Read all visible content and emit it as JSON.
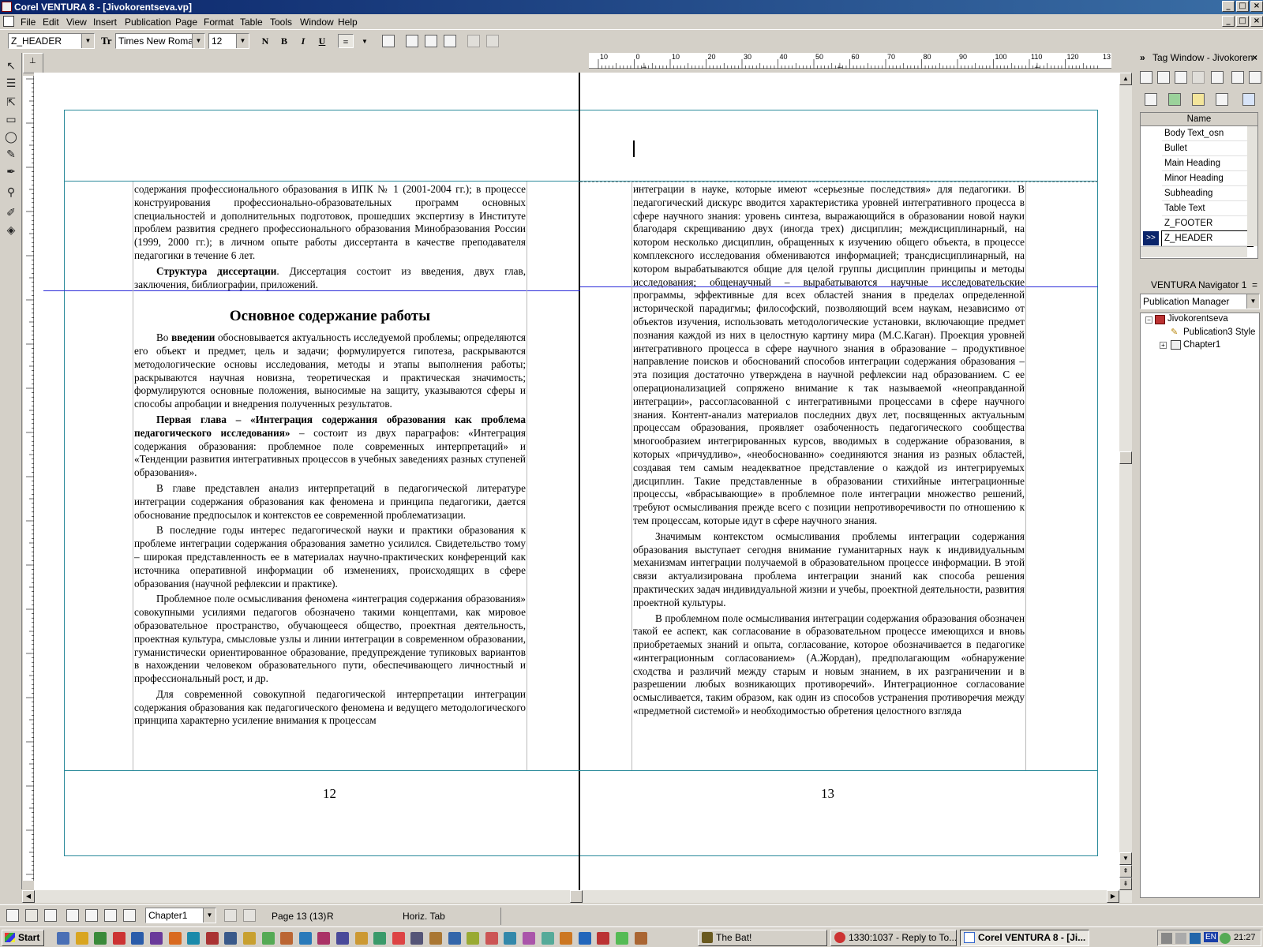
{
  "window": {
    "title": "Corel VENTURA 8 - [Jivokorentseva.vp]"
  },
  "menu": [
    "File",
    "Edit",
    "View",
    "Insert",
    "Publication",
    "Page",
    "Format",
    "Table",
    "Tools",
    "Window",
    "Help"
  ],
  "toolbar": {
    "tag_value": "Z_HEADER",
    "font_value": "Times New Roman",
    "size_value": "12",
    "normal_label": "N",
    "bold_label": "B",
    "italic_label": "I",
    "underline_label": "U"
  },
  "left_page": {
    "paragraph_1": "содержания профессионального образования в ИПК № 1 (2001-2004 гг.); в процессе конструирования профессионально-образовательных программ основных специальностей и дополнительных подготовок, прошедших экспертизу в Институте проблем развития среднего профессионального образования Минобразования России (1999, 2000 гг.); в личном опыте работы диссертанта в качестве преподавателя педагогики в течение 6 лет.",
    "structure_bold": "Структура диссертации",
    "structure_text": ". Диссертация состоит из введения, двух глав, заключения, библиографии, приложений.",
    "heading": "Основное содержание работы",
    "intro_pre": "Во ",
    "intro_bold": "введении",
    "intro_text": " обосновывается актуальность исследуемой проблемы; определяются его объект и предмет, цель и задачи; формулируется гипотеза, раскрываются методологические основы исследования, методы и этапы выполнения работы; раскрываются научная новизна, теоретическая и практическая значимость; формулируются основные положения, выносимые на защиту, указываются сферы и способы апробации и внедрения полученных результатов.",
    "chapter_bold": "Первая глава – «Интеграция содержания образования как проблема педагогического исследования»",
    "chapter_text": " – состоит из двух параграфов: «Интеграция содержания образования: проблемное поле современных интерпретаций» и «Тенденции развития интегративных процессов в учебных заведениях разных ступеней образования».",
    "paragraph_4": "В главе представлен анализ интерпретаций в педагогической литературе интеграции содержания образования как феномена и принципа педагогики, дается обоснование предпосылок и контекстов ее современной проблематизации.",
    "paragraph_5": "В последние годы интерес педагогической науки и практики образования к проблеме интеграции содержания образования заметно усилился. Свидетельство тому – широкая представленность ее в материалах научно-практических конференций как источника оперативной информации об изменениях, происходящих в сфере образования (научной рефлексии и практике).",
    "paragraph_6": "Проблемное поле осмысливания феномена «интеграция содержания образования» совокупными усилиями педагогов обозначено такими концептами, как мировое образовательное пространство, обучающееся общество, проектная деятельность, проектная культура, смысловые узлы и линии интеграции в современном образовании, гуманистически ориентированное образование, предупреждение тупиковых вариантов в нахождении человеком образовательного пути, обеспечивающего личностный и профессиональный рост, и др.",
    "paragraph_7": "Для современной совокупной педагогической интерпретации интеграции содержания образования как педагогического феномена и ведущего методологического принципа характерно усиление внимания к процессам",
    "page_number": "12"
  },
  "right_page": {
    "paragraph_1": "интеграции в науке, которые имеют «серьезные последствия» для педагогики. В педагогический дискурс вводится характеристика уровней интегративного процесса в сфере научного знания: уровень синтеза, выражающийся в образовании новой науки благодаря скрещиванию двух (иногда трех) дисциплин; междисциплинарный, на котором несколько дисциплин, обращенных к изучению общего объекта, в процессе комплексного исследования обмениваются информацией; трансдисциплинарный, на котором вырабатываются общие для целой группы дисциплин принципы и методы исследования; общенаучный – вырабатываются научные исследовательские программы, эффективные для всех областей знания в пределах определенной исторической парадигмы; философский, позволяющий всем наукам, независимо от объектов изучения, использовать методологические установки, включающие предмет познания каждой из них в целостную картину мира (М.С.Каган). Проекция уровней интегративного процесса в сфере научного знания в образование – продуктивное направление поисков и обоснований способов интеграции содержания образования – эта позиция достаточно утверждена в научной рефлексии над образованием. С ее операционализацией сопряжено внимание к так называемой «неоправданной интеграции», рассогласованной с интегративными процессами в сфере научного знания. Контент-анализ материалов последних двух лет, посвященных актуальным процессам образования, проявляет озабоченность педагогического сообщества многообразием интегрированных курсов, вводимых в содержание образования, в которых «причудливо», «необоснованно» соединяются знания из разных областей, создавая тем самым неадекватное представление о каждой из интегрируемых дисциплин. Такие представленные в образовании стихийные интеграционные процессы, «вбрасывающие» в проблемное поле интеграции множество решений, требуют осмысливания прежде всего с позиции непротиворечивости по отношению к тем процессам, которые идут в сфере научного знания.",
    "paragraph_2": "Значимым контекстом осмысливания проблемы интеграции содержания образования выступает сегодня внимание гуманитарных наук к индивидуальным механизмам интеграции получаемой в образовательном процессе информации. В этой связи актуализирована проблема интеграции знаний как способа решения практических задач индивидуальной жизни и учебы, проектной деятельности, развития проектной культуры.",
    "paragraph_3": "В проблемном поле осмысливания интеграции содержания образования обозначен такой ее аспект, как согласование в образовательном процессе имеющихся и вновь приобретаемых знаний и опыта, согласование, которое обозначивается в педагогике «интеграционным согласованием» (А.Жордан), предполагающим «обнаружение сходства и различий между старым и новым знанием, в их разграничении и в разрешении любых возникающих противоречий». Интеграционное согласование осмысливается, таким образом, как один из способов устранения противоречия между «предметной системой» и необходимостью обретения целостного взгляда",
    "page_number": "13"
  },
  "ruler": {
    "labels": [
      "10",
      "0",
      "10",
      "20",
      "30",
      "40",
      "50",
      "60",
      "70",
      "80",
      "90",
      "100",
      "110",
      "120",
      "13"
    ]
  },
  "tag_window": {
    "title": "Tag Window - Jivokoren",
    "column": "Name",
    "tags": [
      "Body Text_osn",
      "Bullet",
      "Main Heading",
      "Minor Heading",
      "Subheading",
      "Table Text",
      "Z_FOOTER",
      "Z_HEADER"
    ],
    "selected": "Z_HEADER",
    "selected_marker": ">>"
  },
  "navigator": {
    "title": "VENTURA Navigator 1",
    "dropdown": "Publication Manager",
    "tree": [
      {
        "label": "Jivokorentseva",
        "level": 0
      },
      {
        "label": "Publication3 Style",
        "level": 1
      },
      {
        "label": "Chapter1",
        "level": 1
      }
    ]
  },
  "status": {
    "chapter": "Chapter1",
    "page": "Page 13 (13)",
    "mode": "R",
    "tab": "Horiz. Tab"
  },
  "taskbar": {
    "start": "Start",
    "tasks": [
      "The Bat!",
      "1330:1037 - Reply to To...",
      "Corel VENTURA 8 - [Ji..."
    ],
    "tray_lang": "EN",
    "clock": "21:27"
  }
}
